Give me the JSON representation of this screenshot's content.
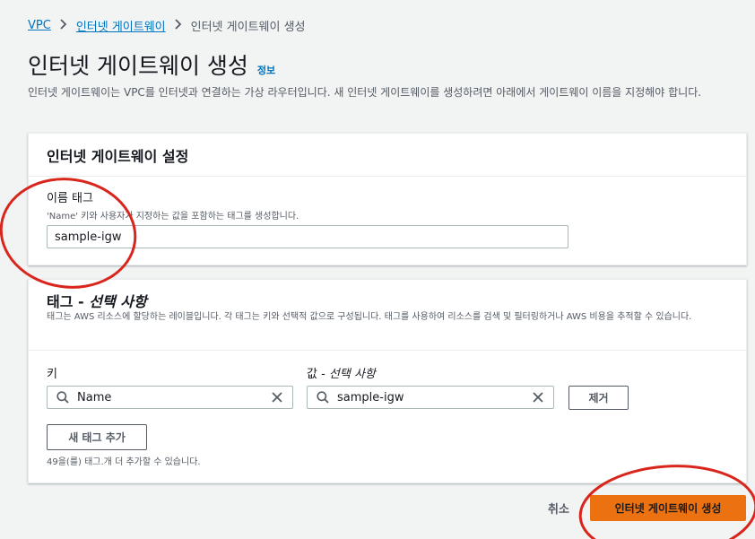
{
  "breadcrumb": {
    "root": "VPC",
    "parent": "인터넷 게이트웨이",
    "current": "인터넷 게이트웨이 생성"
  },
  "page": {
    "title": "인터넷 게이트웨이 생성",
    "info_link": "정보",
    "description": "인터넷 게이트웨이는 VPC를 인터넷과 연결하는 가상 라우터입니다. 새 인터넷 게이트웨이를 생성하려면 아래에서 게이트웨이 이름을 지정해야 합니다."
  },
  "settings_panel": {
    "title": "인터넷 게이트웨이 설정",
    "name_tag_label": "이름 태그",
    "name_tag_description": "'Name' 키와 사용자가 지정하는 값을 포함하는 태그를 생성합니다.",
    "name_tag_value": "sample-igw"
  },
  "tags_panel": {
    "title_main": "태그 - ",
    "title_optional": "선택 사항",
    "description": "태그는 AWS 리소스에 할당하는 레이블입니다. 각 태그는 키와 선택적 값으로 구성됩니다. 태그를 사용하여 리소스를 검색 및 필터링하거나 AWS 비용을 추적할 수 있습니다.",
    "key_label": "키",
    "value_label_main": "값 - ",
    "value_label_optional": "선택 사항",
    "tags": [
      {
        "key": "Name",
        "value": "sample-igw"
      }
    ],
    "remove_label": "제거",
    "add_tag_label": "새 태그 추가",
    "limit_text": "49을(를) 태그.개 더 추가할 수 있습니다."
  },
  "footer": {
    "cancel_label": "취소",
    "create_label": "인터넷 게이트웨이 생성"
  },
  "colors": {
    "link": "#0073bb",
    "primary": "#ec7211",
    "annotation": "#d9261c",
    "background": "#f2f3f3"
  },
  "icons": {
    "breadcrumb_separator": "chevron-right-icon",
    "search": "search-icon",
    "clear": "close-icon"
  }
}
